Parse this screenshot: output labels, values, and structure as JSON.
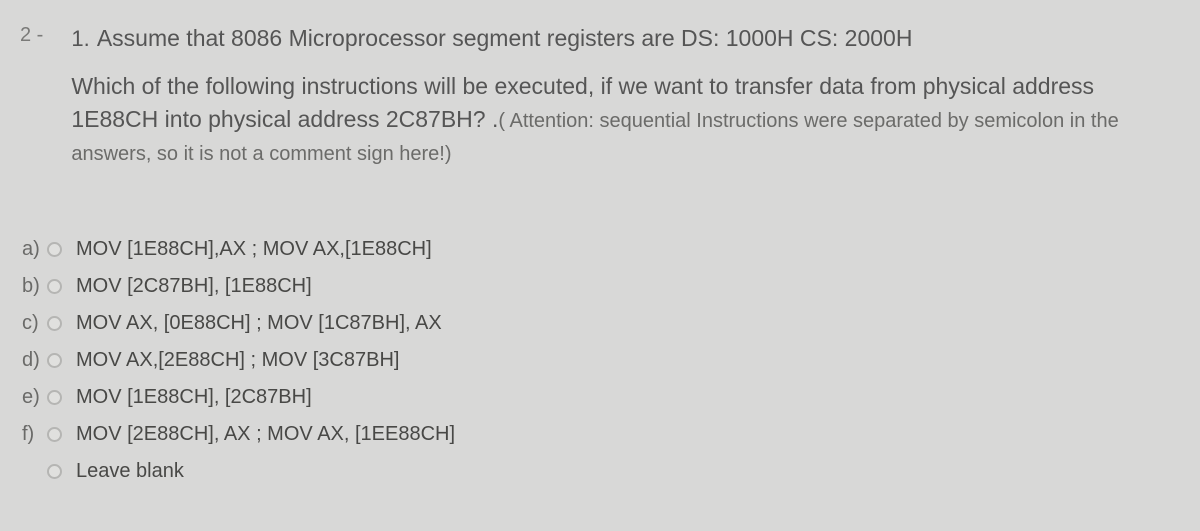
{
  "question": {
    "number": "2 -",
    "prefix": "1.",
    "line1": "Assume that 8086 Microprocessor  segment registers  are DS: 1000H    CS: 2000H",
    "line2": "Which of the following instructions will be executed, if we want to transfer data from physical address  1E88CH into physical address  2C87BH? .",
    "attention": "( Attention: sequential Instructions were separated by semicolon in the answers, so it is not a comment sign here!)"
  },
  "options": [
    {
      "label": "a)",
      "text": "MOV [1E88CH],AX ; MOV AX,[1E88CH]"
    },
    {
      "label": "b)",
      "text": "MOV [2C87BH], [1E88CH]"
    },
    {
      "label": "c)",
      "text": "MOV AX, [0E88CH] ; MOV [1C87BH], AX"
    },
    {
      "label": "d)",
      "text": "MOV AX,[2E88CH] ; MOV [3C87BH]"
    },
    {
      "label": "e)",
      "text": "MOV [1E88CH], [2C87BH]"
    },
    {
      "label": "f)",
      "text": "MOV [2E88CH], AX ; MOV AX, [1EE88CH]"
    }
  ],
  "leave_blank": "Leave blank"
}
